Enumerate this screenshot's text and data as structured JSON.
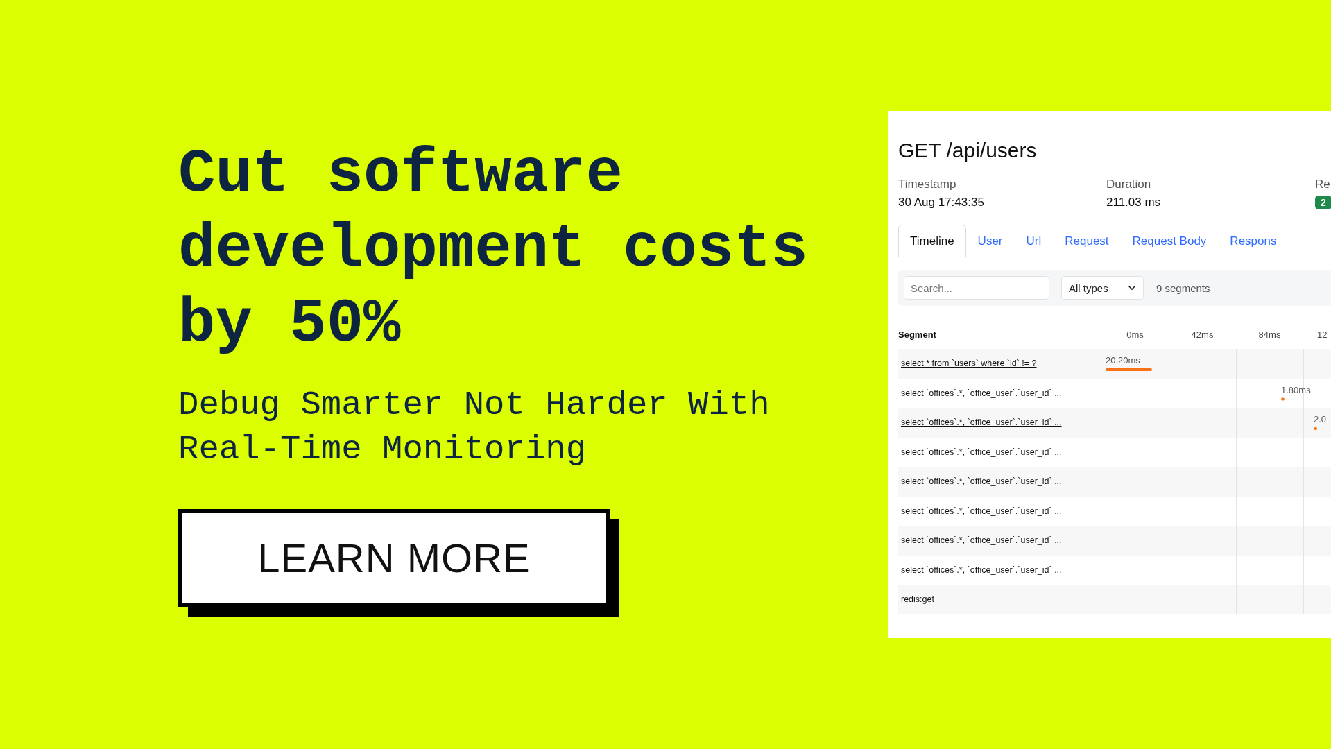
{
  "headline": "Cut software development costs by 50%",
  "subheadline": "Debug Smarter Not Harder With Real-Time Monitoring",
  "cta": "LEARN MORE",
  "panel": {
    "title": "GET /api/users",
    "meta": [
      {
        "label": "Timestamp",
        "value": "30 Aug 17:43:35",
        "kind": "text"
      },
      {
        "label": "Duration",
        "value": "211.03 ms",
        "kind": "text"
      },
      {
        "label": "Re",
        "value": "2",
        "kind": "badge"
      }
    ],
    "tabs": [
      {
        "label": "Timeline",
        "selected": true
      },
      {
        "label": "User",
        "selected": false
      },
      {
        "label": "Url",
        "selected": false
      },
      {
        "label": "Request",
        "selected": false
      },
      {
        "label": "Request Body",
        "selected": false
      },
      {
        "label": "Respons",
        "selected": false
      }
    ],
    "search": {
      "placeholder": "Search..."
    },
    "type_filter": "All types",
    "segment_count": "9 segments",
    "table": {
      "columns": [
        "Segment",
        "0ms",
        "42ms",
        "84ms",
        "12"
      ],
      "rows": [
        {
          "segment": "select * from `users` where `id` != ?",
          "duration": "20.20ms"
        },
        {
          "segment": "select `offices`.*, `office_user`.`user_id` ...",
          "duration": "1.80ms"
        },
        {
          "segment": "select `offices`.*, `office_user`.`user_id` ...",
          "duration": "2.0"
        },
        {
          "segment": "select `offices`.*, `office_user`.`user_id` ..."
        },
        {
          "segment": "select `offices`.*, `office_user`.`user_id` ..."
        },
        {
          "segment": "select `offices`.*, `office_user`.`user_id` ..."
        },
        {
          "segment": "select `offices`.*, `office_user`.`user_id` ..."
        },
        {
          "segment": "select `offices`.*, `office_user`.`user_id` ..."
        },
        {
          "segment": "redis:get"
        }
      ]
    }
  }
}
